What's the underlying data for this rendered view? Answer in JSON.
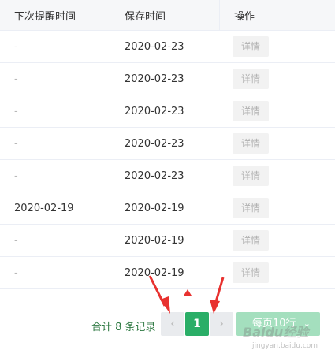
{
  "table": {
    "headers": [
      "下次提醒时间",
      "保存时间",
      "操作"
    ],
    "rows": [
      {
        "next_remind": "-",
        "saved": "2020-02-23",
        "action": "详情"
      },
      {
        "next_remind": "-",
        "saved": "2020-02-23",
        "action": "详情"
      },
      {
        "next_remind": "-",
        "saved": "2020-02-23",
        "action": "详情"
      },
      {
        "next_remind": "-",
        "saved": "2020-02-23",
        "action": "详情"
      },
      {
        "next_remind": "-",
        "saved": "2020-02-23",
        "action": "详情"
      },
      {
        "next_remind": "2020-02-19",
        "saved": "2020-02-19",
        "action": "详情"
      },
      {
        "next_remind": "-",
        "saved": "2020-02-19",
        "action": "详情"
      },
      {
        "next_remind": "-",
        "saved": "2020-02-19",
        "action": "详情"
      }
    ]
  },
  "pagination": {
    "total_text": "合计 8 条记录",
    "prev_icon": "‹",
    "current_page": "1",
    "next_icon": "›",
    "page_size_label": "每页10行",
    "page_size_chevron": "⌄"
  },
  "watermark": {
    "text": "Baidu经验",
    "sub": "jingyan.baidu.com"
  },
  "colors": {
    "accent": "#2aae67",
    "annotation_arrow": "#e8312f"
  }
}
